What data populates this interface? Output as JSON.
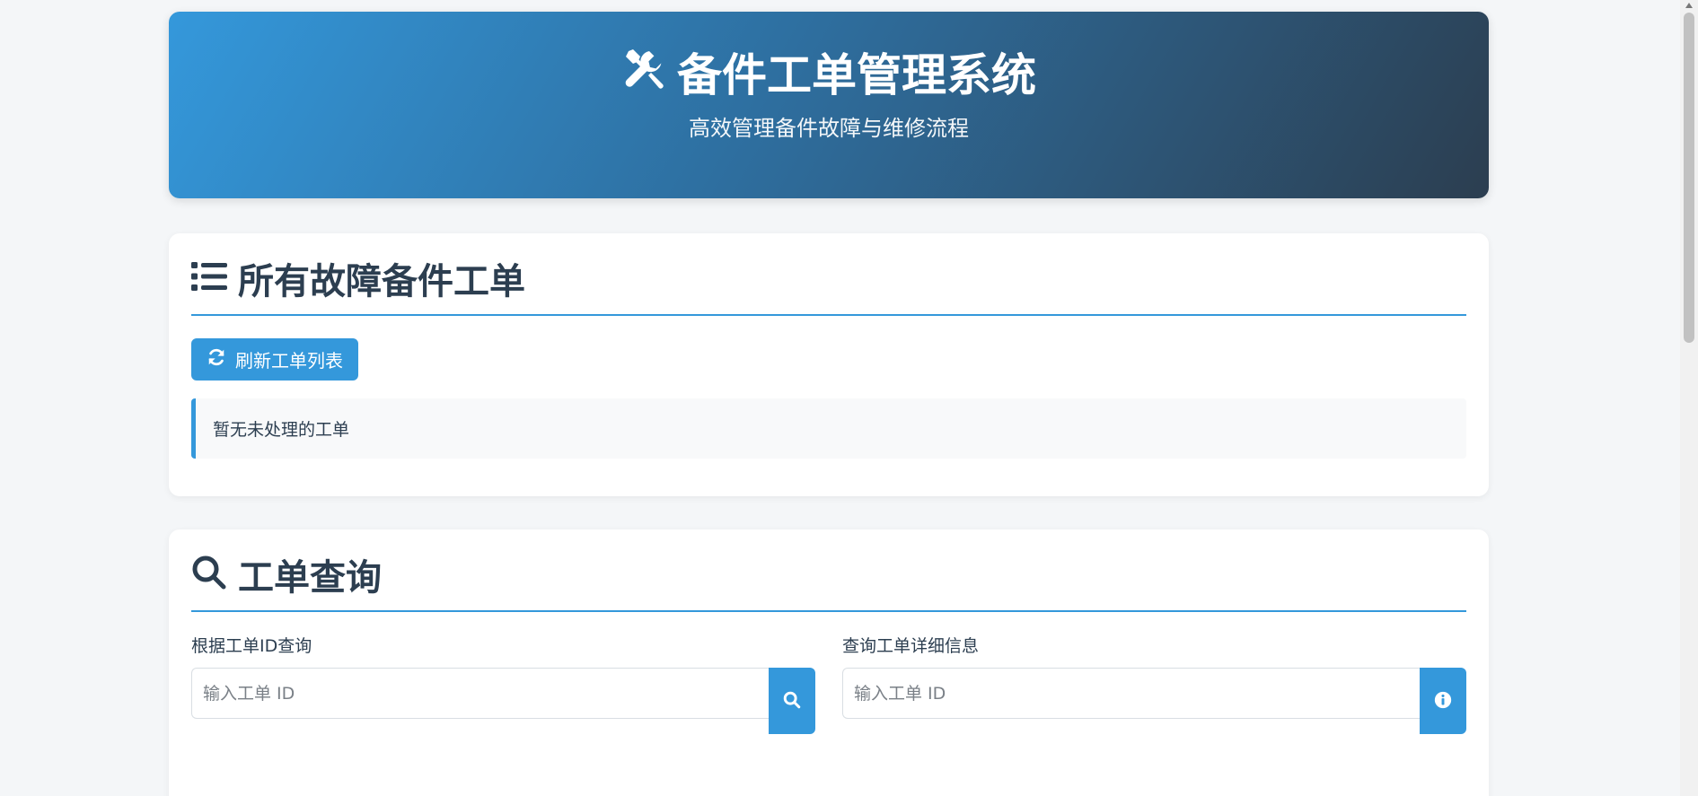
{
  "header": {
    "title": "备件工单管理系统",
    "subtitle": "高效管理备件故障与维修流程",
    "icon": "tools-icon"
  },
  "workorders": {
    "heading": "所有故障备件工单",
    "heading_icon": "list-icon",
    "refresh_label": "刷新工单列表",
    "empty_message": "暂无未处理的工单"
  },
  "query": {
    "heading": "工单查询",
    "heading_icon": "search-icon",
    "by_id": {
      "label": "根据工单ID查询",
      "placeholder": "输入工单 ID",
      "value": ""
    },
    "detail": {
      "label": "查询工单详细信息",
      "placeholder": "输入工单 ID",
      "value": ""
    }
  },
  "colors": {
    "accent": "#3498db",
    "dark": "#2c3e50",
    "background": "#f4f6f8"
  }
}
